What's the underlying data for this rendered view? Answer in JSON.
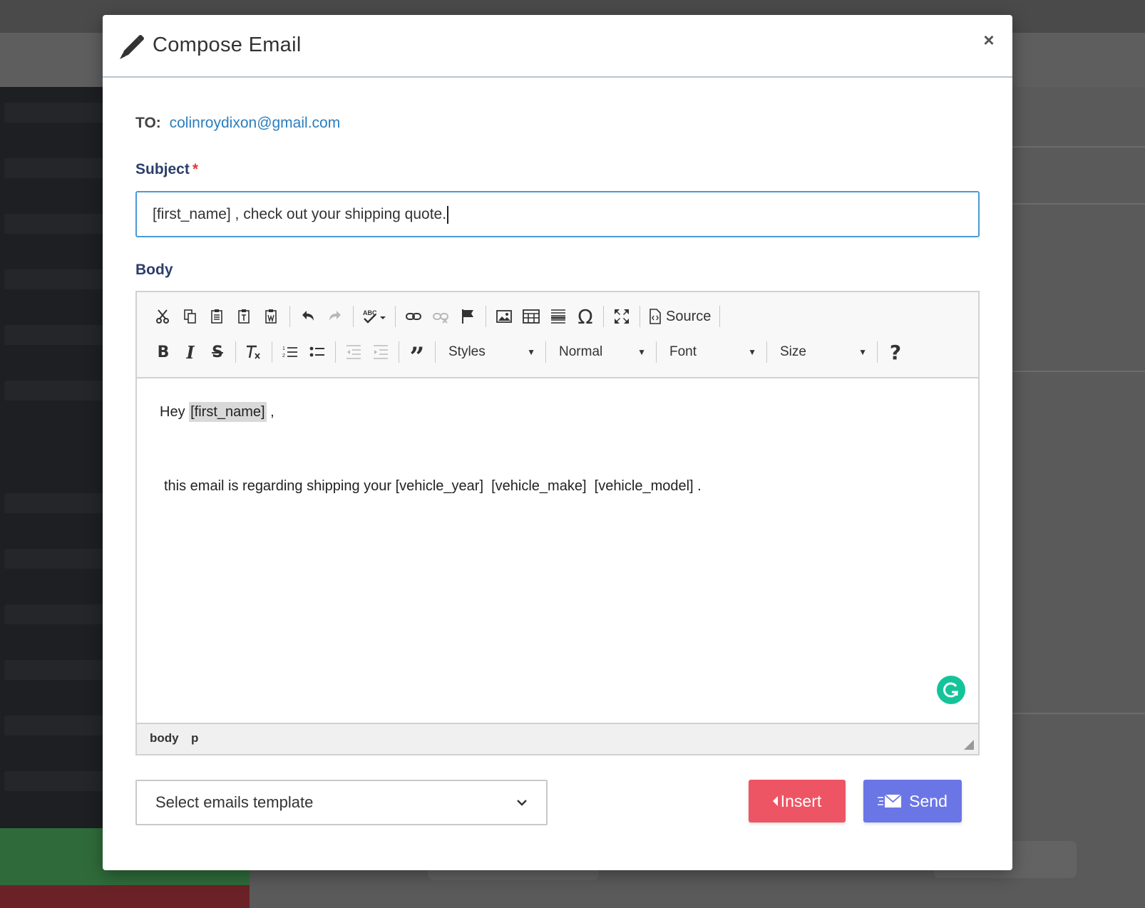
{
  "modal": {
    "title": "Compose Email",
    "close_label": "×"
  },
  "to": {
    "label": "TO:",
    "email": "colinroydixon@gmail.com"
  },
  "subject": {
    "label": "Subject",
    "required_mark": "*",
    "value": "[first_name] , check out your shipping quote."
  },
  "body": {
    "label": "Body",
    "toolbar": {
      "source_label": "Source",
      "styles_label": "Styles",
      "format_label": "Normal",
      "font_label": "Font",
      "size_label": "Size",
      "help_label": "?"
    },
    "content": {
      "greeting_prefix": "Hey ",
      "greeting_placeholder": "[first_name]",
      "greeting_suffix": " ,",
      "paragraph": "this email is regarding shipping your [vehicle_year]  [vehicle_make]  [vehicle_model] ."
    },
    "statusbar": {
      "path_body": "body",
      "path_p": "p"
    }
  },
  "template_select": {
    "placeholder": "Select emails template"
  },
  "buttons": {
    "insert_label": "Insert",
    "send_label": "Send"
  },
  "colors": {
    "accent_link": "#2a7ebf",
    "insert_button": "#ed5565",
    "send_button": "#6b76e6",
    "required": "#e53935",
    "grammarly": "#15c39a"
  }
}
